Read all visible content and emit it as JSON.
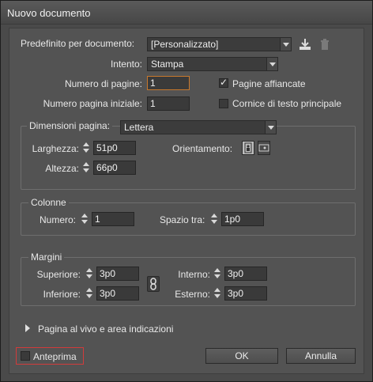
{
  "window": {
    "title": "Nuovo documento"
  },
  "preset": {
    "label": "Predefinito per documento:",
    "value": "[Personalizzato]"
  },
  "intent": {
    "label": "Intento:",
    "value": "Stampa"
  },
  "pages": {
    "label": "Numero di pagine:",
    "value": "1"
  },
  "start_page": {
    "label": "Numero pagina iniziale:",
    "value": "1"
  },
  "facing_pages": {
    "label": "Pagine affiancate",
    "checked": true
  },
  "primary_text_frame": {
    "label": "Cornice di testo principale",
    "checked": false
  },
  "page_size": {
    "label": "Dimensioni pagina:",
    "value": "Lettera",
    "width_label": "Larghezza:",
    "width": "51p0",
    "height_label": "Altezza:",
    "height": "66p0",
    "orientation_label": "Orientamento:"
  },
  "columns": {
    "legend": "Colonne",
    "number_label": "Numero:",
    "number": "1",
    "gutter_label": "Spazio tra:",
    "gutter": "1p0"
  },
  "margins": {
    "legend": "Margini",
    "top_label": "Superiore:",
    "top": "3p0",
    "bottom_label": "Inferiore:",
    "bottom": "3p0",
    "inside_label": "Interno:",
    "inside": "3p0",
    "outside_label": "Esterno:",
    "outside": "3p0"
  },
  "bleed": {
    "label": "Pagina al vivo e area indicazioni"
  },
  "preview": {
    "label": "Anteprima",
    "checked": false
  },
  "buttons": {
    "ok": "OK",
    "cancel": "Annulla"
  },
  "icons": {
    "save_preset": "save-preset-icon",
    "delete_preset": "trash-icon",
    "portrait": "portrait-icon",
    "landscape": "landscape-icon",
    "chain": "chain-link-icon"
  },
  "colors": {
    "focus_border": "#c8782c",
    "preview_outline": "#d23b3b"
  }
}
